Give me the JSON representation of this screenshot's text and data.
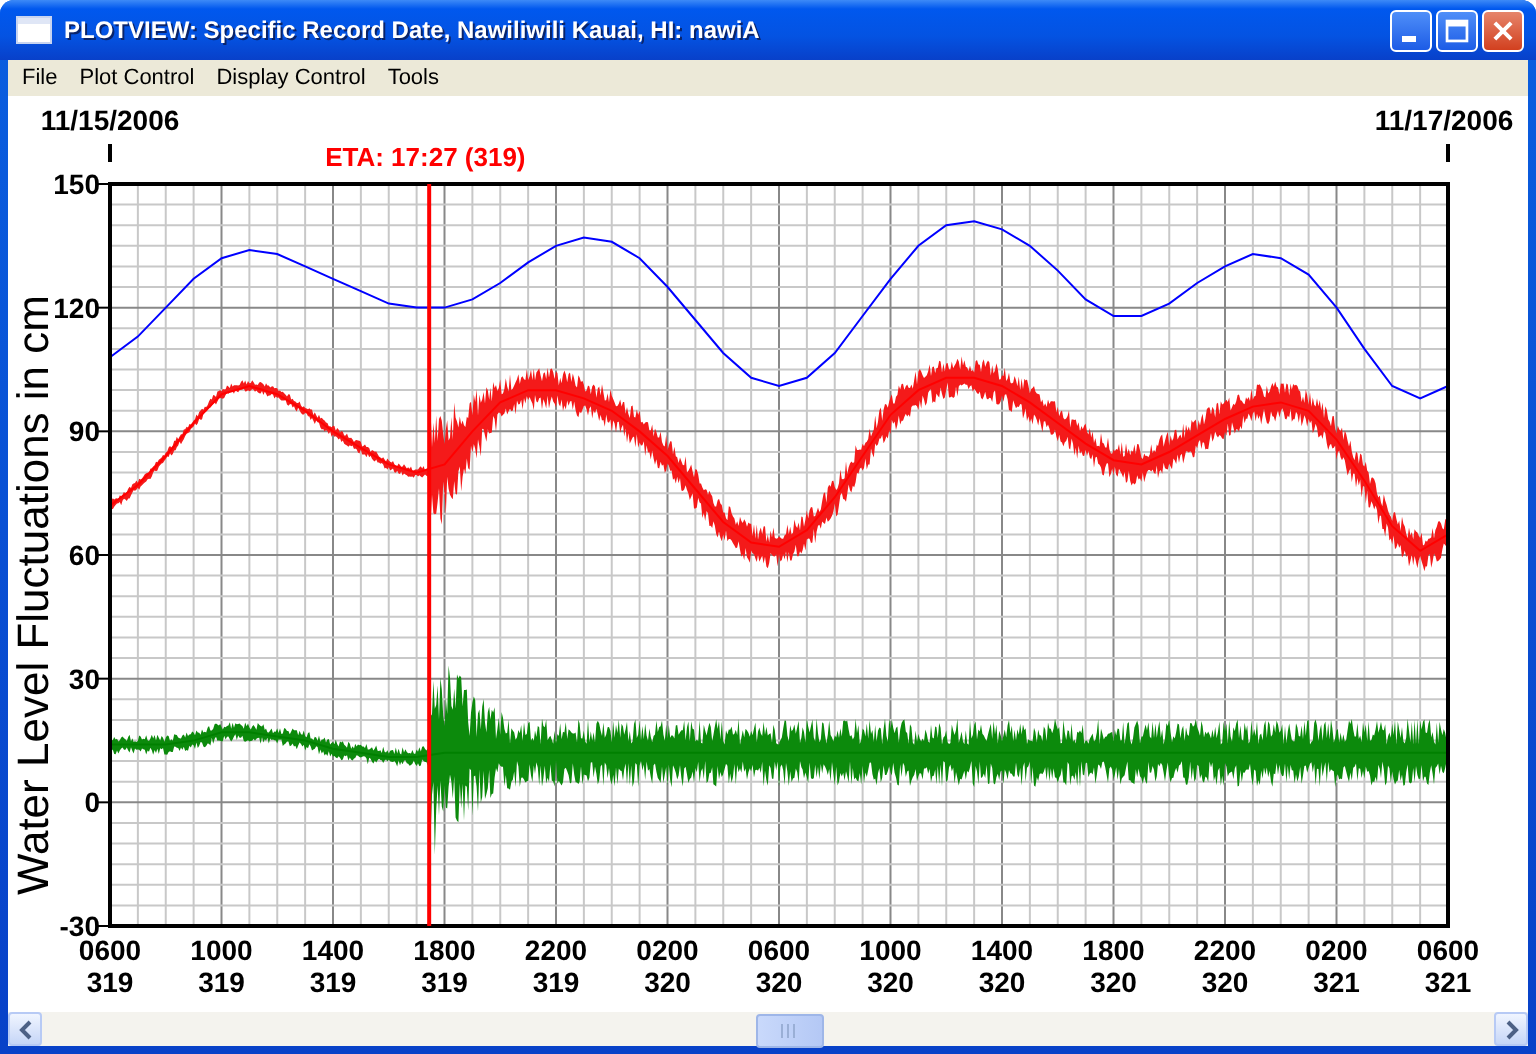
{
  "window": {
    "title": "PLOTVIEW: Specific Record Date, Nawiliwili Kauai, HI: nawiA"
  },
  "menu": [
    "File",
    "Plot Control",
    "Display Control",
    "Tools"
  ],
  "plot": {
    "start_date": "11/15/2006",
    "end_date": "11/17/2006",
    "chart_data": {
      "type": "line",
      "ylabel": "Water Level Fluctuations in cm",
      "categories": [
        "0600\n319",
        null,
        null,
        null,
        "1000\n319",
        null,
        null,
        null,
        "1400\n319",
        null,
        null,
        null,
        "1800\n319",
        null,
        null,
        null,
        "2200\n319",
        null,
        null,
        null,
        "0200\n320",
        null,
        null,
        null,
        "0600\n320",
        null,
        null,
        null,
        "1000\n320",
        null,
        null,
        null,
        "1400\n320",
        null,
        null,
        null,
        "1800\n320",
        null,
        null,
        null,
        "2200\n320",
        null,
        null,
        null,
        "0200\n321",
        null,
        null,
        null,
        "0600\n321"
      ],
      "series": [
        {
          "color": "#0000ff",
          "values": [
            108,
            113,
            120,
            127,
            132,
            134,
            133,
            130,
            127,
            124,
            121,
            120,
            120,
            122,
            126,
            131,
            135,
            137,
            136,
            132,
            125,
            117,
            109,
            103,
            101,
            103,
            109,
            118,
            127,
            135,
            140,
            141,
            139,
            135,
            129,
            122,
            118,
            118,
            121,
            126,
            130,
            133,
            132,
            128,
            120,
            110,
            101,
            98,
            101
          ]
        },
        {
          "color": "#ff0000",
          "values": [
            72,
            77,
            84,
            92,
            99,
            101,
            99,
            95,
            90,
            86,
            82,
            80,
            82,
            90,
            97,
            100,
            100,
            98,
            95,
            90,
            84,
            76,
            68,
            63,
            62,
            66,
            74,
            84,
            94,
            100,
            103,
            103,
            101,
            97,
            92,
            87,
            83,
            82,
            85,
            89,
            93,
            96,
            97,
            95,
            88,
            78,
            67,
            61,
            65
          ]
        },
        {
          "color": "#008000",
          "values": [
            14,
            14,
            14,
            15,
            17,
            17,
            16,
            15,
            13,
            12,
            11,
            11,
            12,
            12,
            12,
            12,
            12,
            12,
            12,
            12,
            12,
            12,
            12,
            12,
            12,
            12,
            12,
            12,
            12,
            12,
            12,
            12,
            12,
            12,
            12,
            12,
            12,
            12,
            12,
            12,
            12,
            12,
            12,
            12,
            12,
            12,
            12,
            12,
            12
          ]
        }
      ],
      "grid": true,
      "ylim": [
        -30,
        150
      ],
      "yticks": [
        -30,
        0,
        30,
        60,
        90,
        120,
        150
      ],
      "annotations": [
        "ETA: 17:27 (319)"
      ]
    }
  }
}
